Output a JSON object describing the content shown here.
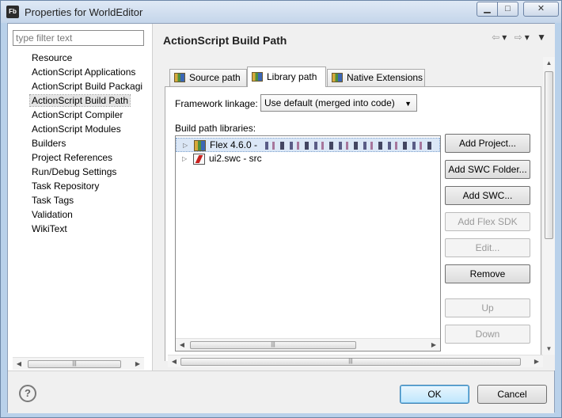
{
  "window": {
    "title": "Properties for WorldEditor",
    "icon_text": "Fb"
  },
  "left_pane": {
    "filter_placeholder": "type filter text",
    "items": [
      "Resource",
      "ActionScript Applications",
      "ActionScript Build Packagi",
      "ActionScript Build Path",
      "ActionScript Compiler",
      "ActionScript Modules",
      "Builders",
      "Project References",
      "Run/Debug Settings",
      "Task Repository",
      "Task Tags",
      "Validation",
      "WikiText"
    ],
    "selected_index": 3
  },
  "page": {
    "title": "ActionScript Build Path",
    "tabs": [
      "Source path",
      "Library path",
      "Native Extensions"
    ],
    "active_tab": "Library path",
    "framework_label": "Framework linkage:",
    "framework_value": "Use default (merged into code)",
    "libraries_label": "Build path libraries:",
    "libraries": [
      {
        "label": "Flex 4.6.0 - ",
        "icon": "flex-sdk-icon",
        "selected": true
      },
      {
        "label": "ui2.swc - src",
        "icon": "swc-file-icon",
        "selected": false
      }
    ],
    "buttons": [
      {
        "label": "Add Project...",
        "enabled": true
      },
      {
        "label": "Add SWC Folder...",
        "enabled": true
      },
      {
        "label": "Add SWC...",
        "enabled": true
      },
      {
        "label": "Add Flex SDK",
        "enabled": false
      },
      {
        "label": "Edit...",
        "enabled": false
      },
      {
        "label": "Remove",
        "enabled": true
      },
      {
        "label": "Up",
        "enabled": false
      },
      {
        "label": "Down",
        "enabled": false
      }
    ]
  },
  "footer": {
    "help_label": "?",
    "ok_label": "OK",
    "cancel_label": "Cancel"
  }
}
